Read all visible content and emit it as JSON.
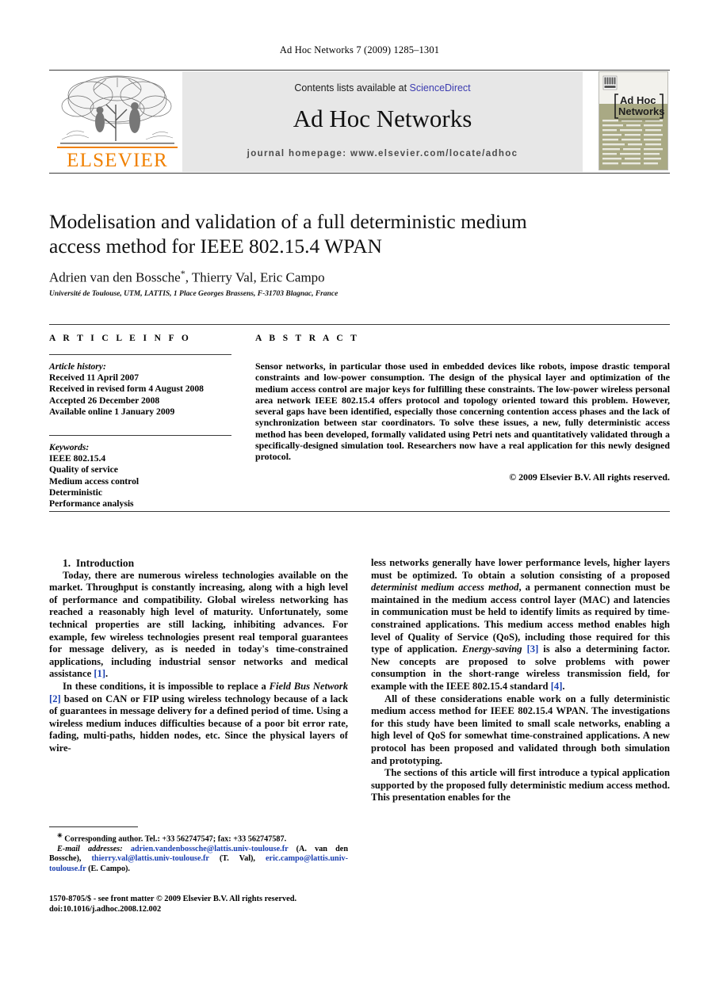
{
  "running_head": "Ad Hoc Networks 7 (2009) 1285–1301",
  "masthead": {
    "contents_prefix": "Contents lists available at ",
    "sciencedirect": "ScienceDirect",
    "journal_title": "Ad Hoc Networks",
    "homepage": "journal homepage: www.elsevier.com/locate/adhoc",
    "publisher_wordmark": "ELSEVIER",
    "cover_title_line1": "Ad Hoc",
    "cover_title_line2": "Networks",
    "colors": {
      "elsevier_orange": "#F08000",
      "sciencedirect_blue": "#3b3bb0",
      "band_grey": "#e7e7e7",
      "cover_olive": "#a9a984",
      "link_blue": "#1a3fb0"
    }
  },
  "article": {
    "title": "Modelisation and validation of a full deterministic medium access method for IEEE 802.15.4 WPAN",
    "authors": "Adrien van den Bossche",
    "authors_rest": ", Thierry Val, Eric Campo",
    "corresponding_marker": "*",
    "affiliation": "Université de Toulouse, UTM, LATTIS, 1 Place Georges Brassens, F-31703 Blagnac, France"
  },
  "info": {
    "heading": "A R T I C L E  I N F O",
    "history_label": "Article history:",
    "history": [
      "Received 11 April 2007",
      "Received in revised form 4 August 2008",
      "Accepted 26 December 2008",
      "Available online 1 January 2009"
    ],
    "keywords_label": "Keywords:",
    "keywords": [
      "IEEE 802.15.4",
      "Quality of service",
      "Medium access control",
      "Deterministic",
      "Performance analysis"
    ]
  },
  "abstract": {
    "heading": "A B S T R A C T",
    "text": "Sensor networks, in particular those used in embedded devices like robots, impose drastic temporal constraints and low-power consumption. The design of the physical layer and optimization of the medium access control are major keys for fulfilling these constraints. The low-power wireless personal area network IEEE 802.15.4 offers protocol and topology oriented toward this problem. However, several gaps have been identified, especially those concerning contention access phases and the lack of synchronization between star coordinators. To solve these issues, a new, fully deterministic access method has been developed, formally validated using Petri nets and quantitatively validated through a specifically-designed simulation tool. Researchers now have a real application for this newly designed protocol.",
    "copyright": "© 2009 Elsevier B.V. All rights reserved."
  },
  "body": {
    "section_number": "1.",
    "section_title": "Introduction",
    "left_p1": "Today, there are numerous wireless technologies available on the market. Throughput is constantly increasing, along with a high level of performance and compatibility. Global wireless networking has reached a reasonably high level of maturity. Unfortunately, some technical properties are still lacking, inhibiting advances. For example, few wireless technologies present real temporal guarantees for message delivery, as is needed in today's time-constrained applications, including industrial sensor networks and medical assistance ",
    "left_p1_ref": "[1]",
    "left_p1_end": ".",
    "left_p2_a": "In these conditions, it is impossible to replace a ",
    "left_p2_it1": "Field Bus Network",
    "left_p2_b": " ",
    "left_p2_ref": "[2]",
    "left_p2_c": " based on CAN or FIP using wireless technology because of a lack of guarantees in message delivery for a defined period of time. Using a wireless medium induces difficulties because of a poor bit error rate, fading, multi-paths, hidden nodes, etc. Since the physical layers of wire-",
    "right_p1_a": "less networks generally have lower performance levels, higher layers must be optimized. To obtain a solution consisting of a proposed ",
    "right_p1_it1": "determinist medium access method",
    "right_p1_b": ", a permanent connection must be maintained in the medium access control layer (MAC) and latencies in communication must be held to identify limits as required by time-constrained applications. This medium access method enables high level of Quality of Service (QoS), including those required for this type of application. ",
    "right_p1_it2": "Energy-saving",
    "right_p1_c": " ",
    "right_p1_ref1": "[3]",
    "right_p1_d": " is also a determining factor. New concepts are proposed to solve problems with power consumption in the short-range wireless transmission field, for example with the IEEE 802.15.4 standard ",
    "right_p1_ref2": "[4]",
    "right_p1_e": ".",
    "right_p2": "All of these considerations enable work on a fully deterministic medium access method for IEEE 802.15.4 WPAN. The investigations for this study have been limited to small scale networks, enabling a high level of QoS for somewhat time-constrained applications. A new protocol has been proposed and validated through both simulation and prototyping.",
    "right_p3": "The sections of this article will first introduce a typical application supported by the proposed fully deterministic medium access method. This presentation enables for the"
  },
  "footnotes": {
    "corresponding": "Corresponding author. Tel.: +33 562747547; fax: +33 562747587.",
    "email_label": "E-mail addresses:",
    "email1": "adrien.vandenbossche@lattis.univ-toulouse.fr",
    "email1_name": " (A. van den Bossche), ",
    "email2": "thierry.val@lattis.univ-toulouse.fr",
    "email2_name": " (T. Val), ",
    "email3": "eric.campo@lattis.univ-toulouse.fr",
    "email3_name": " (E. Campo)."
  },
  "imprint": {
    "line1": "1570-8705/$ - see front matter © 2009 Elsevier B.V. All rights reserved.",
    "line2": "doi:10.1016/j.adhoc.2008.12.002"
  }
}
